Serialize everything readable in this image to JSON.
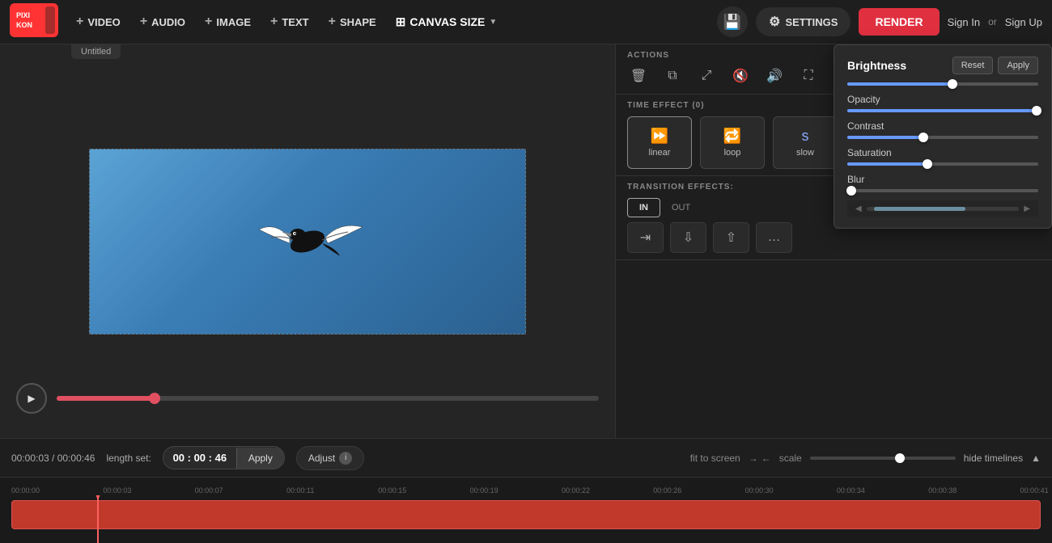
{
  "app": {
    "logo_text": "PIXIKON",
    "untitled_label": "Untitled"
  },
  "nav": {
    "video_label": "VIDEO",
    "audio_label": "AUDIO",
    "image_label": "IMAGE",
    "text_label": "TEXT",
    "shape_label": "SHAPE",
    "canvas_size_label": "CANVAS SIZE"
  },
  "nav_right": {
    "settings_label": "SETTINGS",
    "render_label": "RENDER",
    "sign_in_label": "Sign In",
    "or_label": "or",
    "sign_up_label": "Sign Up"
  },
  "actions": {
    "section_label": "ACTIONS"
  },
  "time_effect": {
    "section_label": "TIME EFFECT (0)",
    "linear_label": "linear",
    "loop_label": "loop",
    "slow_label": "slow"
  },
  "transition": {
    "section_label": "TRANSITION EFFECTS:",
    "in_label": "IN",
    "out_label": "OUT"
  },
  "brightness_panel": {
    "title": "Brightness",
    "reset_label": "Reset",
    "apply_label": "Apply",
    "opacity_label": "Opacity",
    "contrast_label": "Contrast",
    "saturation_label": "Saturation",
    "blur_label": "Blur",
    "brightness_thumb_pct": 55,
    "opacity_thumb_pct": 99,
    "contrast_thumb_pct": 40,
    "saturation_thumb_pct": 42,
    "blur_thumb_pct": 2
  },
  "timeline": {
    "time_display": "00:00:03 / 00:00:46",
    "length_set_label": "length set:",
    "length_value": "00 : 00 : 46",
    "apply_label": "Apply",
    "adjust_label": "Adjust",
    "fit_to_screen_label": "fit to screen",
    "scale_label": "scale",
    "hide_timelines_label": "hide timelines",
    "scale_position_pct": 62
  },
  "ruler": {
    "marks": [
      "00:00:00",
      "00:00:03",
      "00:00:07",
      "00:00:11",
      "00:00:15",
      "00:00:19",
      "00:00:22",
      "00:00:26",
      "00:00:30",
      "00:00:34",
      "00:00:38",
      "00:00:41"
    ]
  }
}
